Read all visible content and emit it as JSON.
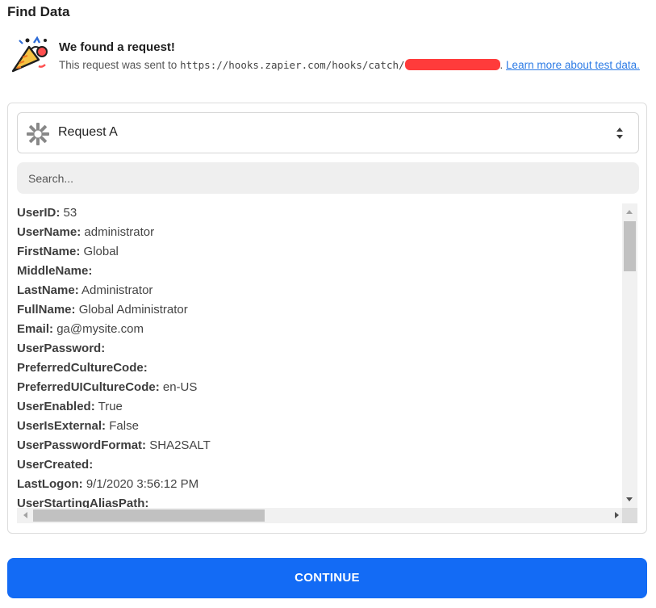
{
  "page": {
    "title": "Find Data"
  },
  "banner": {
    "icon": "party-popper-icon",
    "heading": "We found a request!",
    "text_prefix": "This request was sent to ",
    "url": "https://hooks.zapier.com/hooks/catch/",
    "text_after_url": ". ",
    "link_text": "Learn more about test data."
  },
  "request_select": {
    "icon": "zapier-gear-icon",
    "value": "Request A"
  },
  "search": {
    "placeholder": "Search..."
  },
  "fields": [
    {
      "key": "UserID:",
      "value": "53"
    },
    {
      "key": "UserName:",
      "value": "administrator"
    },
    {
      "key": "FirstName:",
      "value": "Global"
    },
    {
      "key": "MiddleName:",
      "value": ""
    },
    {
      "key": "LastName:",
      "value": "Administrator"
    },
    {
      "key": "FullName:",
      "value": "Global Administrator"
    },
    {
      "key": "Email:",
      "value": "ga@mysite.com"
    },
    {
      "key": "UserPassword:",
      "value": ""
    },
    {
      "key": "PreferredCultureCode:",
      "value": ""
    },
    {
      "key": "PreferredUICultureCode:",
      "value": "en-US"
    },
    {
      "key": "UserEnabled:",
      "value": "True"
    },
    {
      "key": "UserIsExternal:",
      "value": "False"
    },
    {
      "key": "UserPasswordFormat:",
      "value": "SHA2SALT"
    },
    {
      "key": "UserCreated:",
      "value": ""
    },
    {
      "key": "LastLogon:",
      "value": "9/1/2020 3:56:12 PM"
    },
    {
      "key": "UserStartingAliasPath:",
      "value": ""
    }
  ],
  "actions": {
    "continue_label": "CONTINUE"
  },
  "colors": {
    "primary": "#136bf5",
    "link": "#2c7be5",
    "redaction": "#ff3b3b"
  }
}
